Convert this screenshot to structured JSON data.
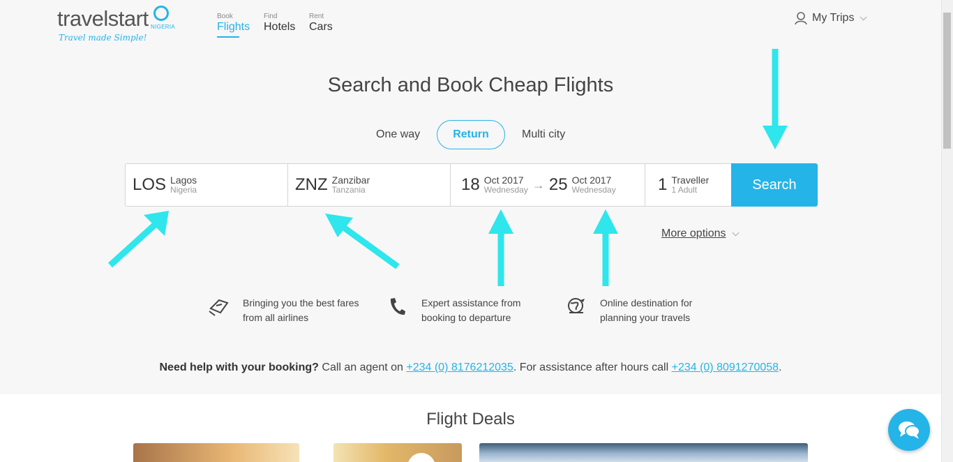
{
  "brand": {
    "name": "travelstart",
    "country": "NIGERIA",
    "tagline": "Travel made Simple!",
    "accent_color": "#24b4e8"
  },
  "nav": [
    {
      "small": "Book",
      "label": "Flights",
      "active": true
    },
    {
      "small": "Find",
      "label": "Hotels",
      "active": false
    },
    {
      "small": "Rent",
      "label": "Cars",
      "active": false
    }
  ],
  "account": {
    "label": "My Trips",
    "icon": "user-icon"
  },
  "title": "Search and Book Cheap Flights",
  "trip_types": [
    "One way",
    "Return",
    "Multi city"
  ],
  "selected_trip_type": "Return",
  "search": {
    "from": {
      "code": "LOS",
      "city": "Lagos",
      "country": "Nigeria"
    },
    "to": {
      "code": "ZNZ",
      "city": "Zanzibar",
      "country": "Tanzania"
    },
    "depart": {
      "day": "18",
      "month": "Oct 2017",
      "weekday": "Wednesday"
    },
    "return": {
      "day": "25",
      "month": "Oct 2017",
      "weekday": "Wednesday"
    },
    "travellers": {
      "count": "1",
      "label": "Traveller",
      "detail": "1 Adult"
    },
    "button": "Search"
  },
  "more_options": "More options",
  "features": [
    {
      "icon": "ticket-hand-icon",
      "text": "Bringing you the best fares from all airlines"
    },
    {
      "icon": "phone-icon",
      "text": "Expert assistance from booking to departure"
    },
    {
      "icon": "globe-plane-icon",
      "text": "Online destination for planning your travels"
    }
  ],
  "help": {
    "lead": "Need help with your booking?",
    "text1": " Call an agent on ",
    "phone1": "+234 (0) 8176212035",
    "text2": ". For assistance after hours call ",
    "phone2": "+234 (0) 8091270058",
    "text3": "."
  },
  "deals_title": "Flight Deals",
  "chat": {
    "icon": "chat-bubbles-icon"
  },
  "annotation_color": "#2ee6ec"
}
